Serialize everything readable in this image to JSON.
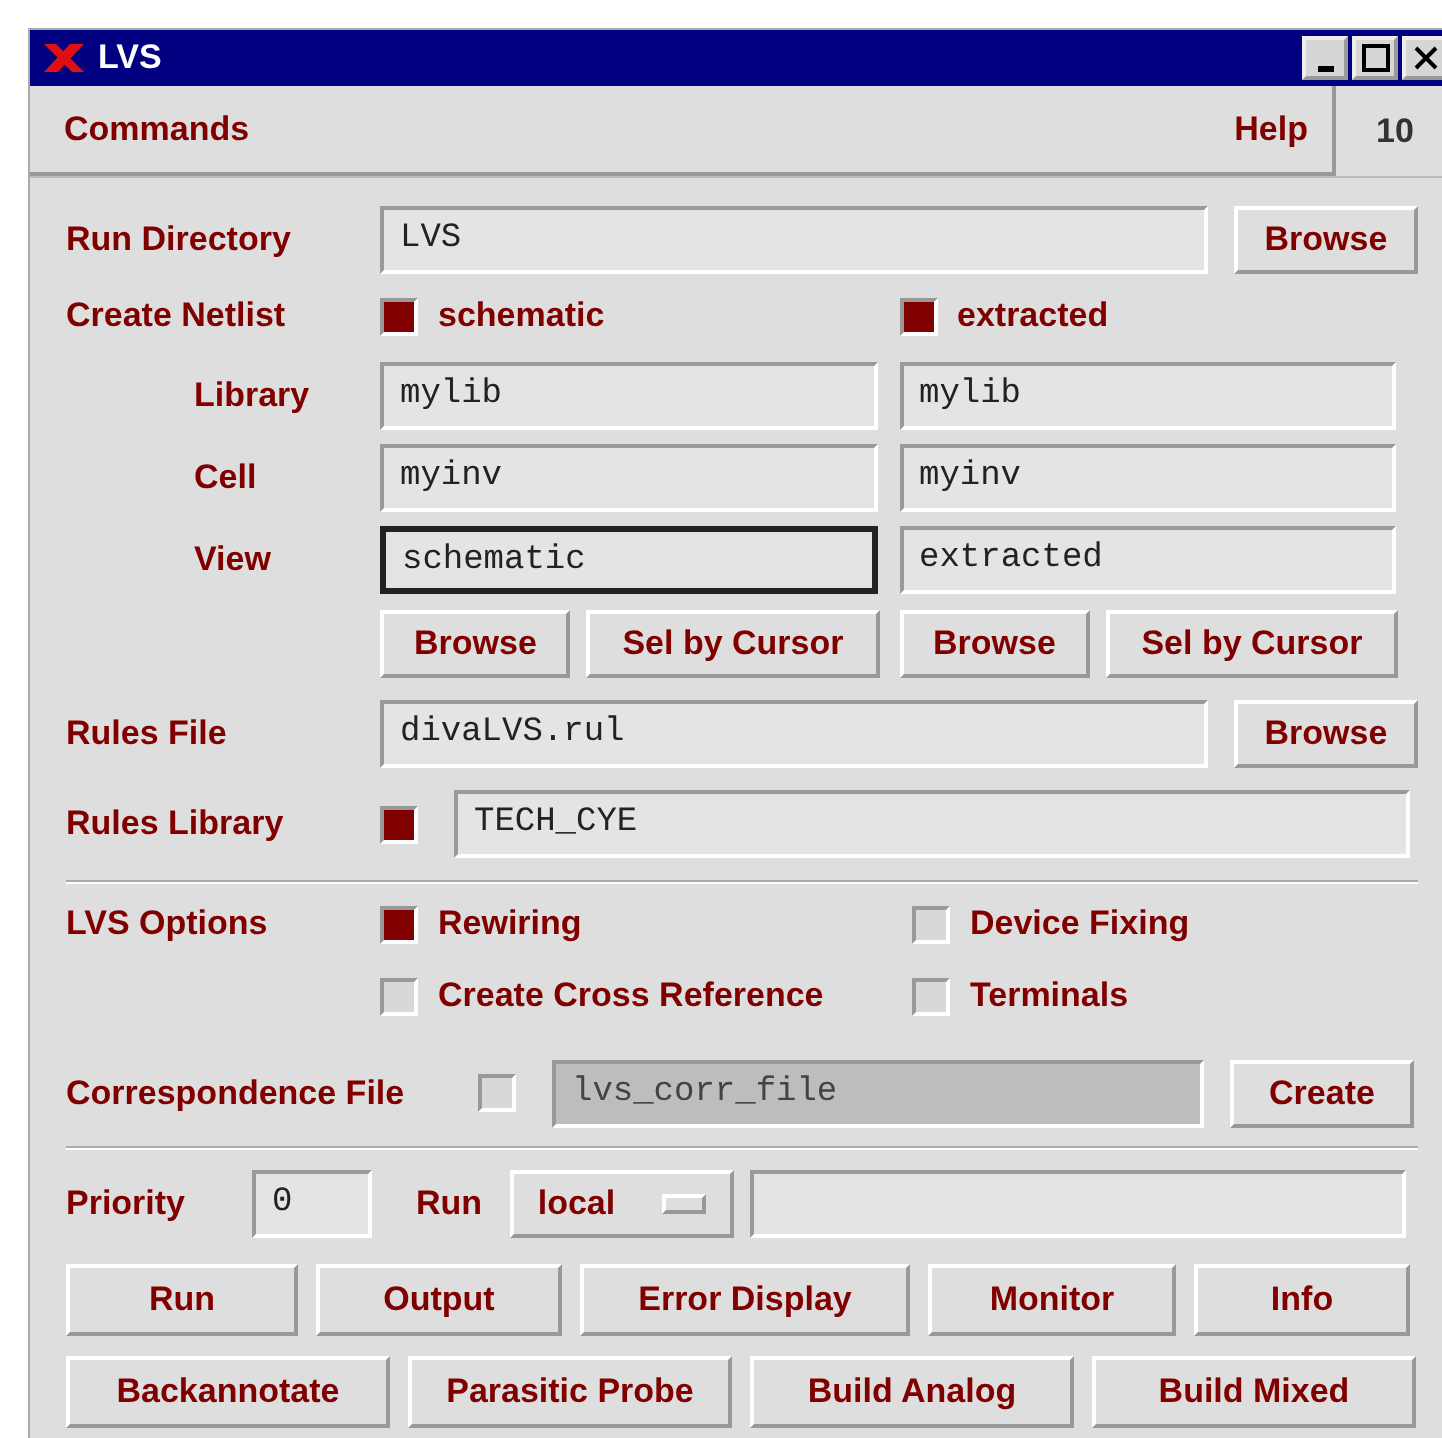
{
  "window": {
    "title": "LVS"
  },
  "menu": {
    "items": [
      {
        "label": "Commands"
      },
      {
        "label": "Help"
      }
    ],
    "counter": "10"
  },
  "run_directory": {
    "label": "Run Directory",
    "value": "LVS",
    "button": "Browse"
  },
  "create_netlist": {
    "label": "Create Netlist",
    "options": [
      {
        "label": "schematic",
        "checked": true
      },
      {
        "label": "extracted",
        "checked": true
      }
    ]
  },
  "netlist_fields": [
    {
      "label": "Library",
      "cells": [
        {
          "value": "mylib",
          "focused": false
        },
        {
          "value": "mylib",
          "focused": false
        }
      ]
    },
    {
      "label": "Cell",
      "cells": [
        {
          "value": "myinv",
          "focused": false
        },
        {
          "value": "myinv",
          "focused": false
        }
      ]
    },
    {
      "label": "View",
      "cells": [
        {
          "value": "schematic",
          "focused": true
        },
        {
          "value": "extracted",
          "focused": false
        }
      ]
    }
  ],
  "netlist_buttons": [
    "Browse",
    "Sel by Cursor",
    "Browse",
    "Sel by Cursor"
  ],
  "rules_file": {
    "label": "Rules File",
    "value": "divaLVS.rul",
    "button": "Browse"
  },
  "rules_library": {
    "label": "Rules Library",
    "checked": true,
    "value": "TECH_CYE"
  },
  "lvs_options": {
    "label": "LVS Options",
    "options": [
      {
        "label": "Rewiring",
        "checked": true
      },
      {
        "label": "Device Fixing",
        "checked": false
      },
      {
        "label": "Create Cross Reference",
        "checked": false
      },
      {
        "label": "Terminals",
        "checked": false
      }
    ]
  },
  "correspondence": {
    "label": "Correspondence File",
    "checked": false,
    "value": "lvs_corr_file",
    "disabled": true,
    "button": "Create"
  },
  "priority": {
    "label": "Priority",
    "value": "0"
  },
  "run": {
    "label": "Run",
    "selection": "local"
  },
  "action_rows": [
    [
      "Run",
      "Output",
      "Error Display",
      "Monitor",
      "Info"
    ],
    [
      "Backannotate",
      "Parasitic Probe",
      "Build Analog",
      "Build Mixed"
    ]
  ]
}
